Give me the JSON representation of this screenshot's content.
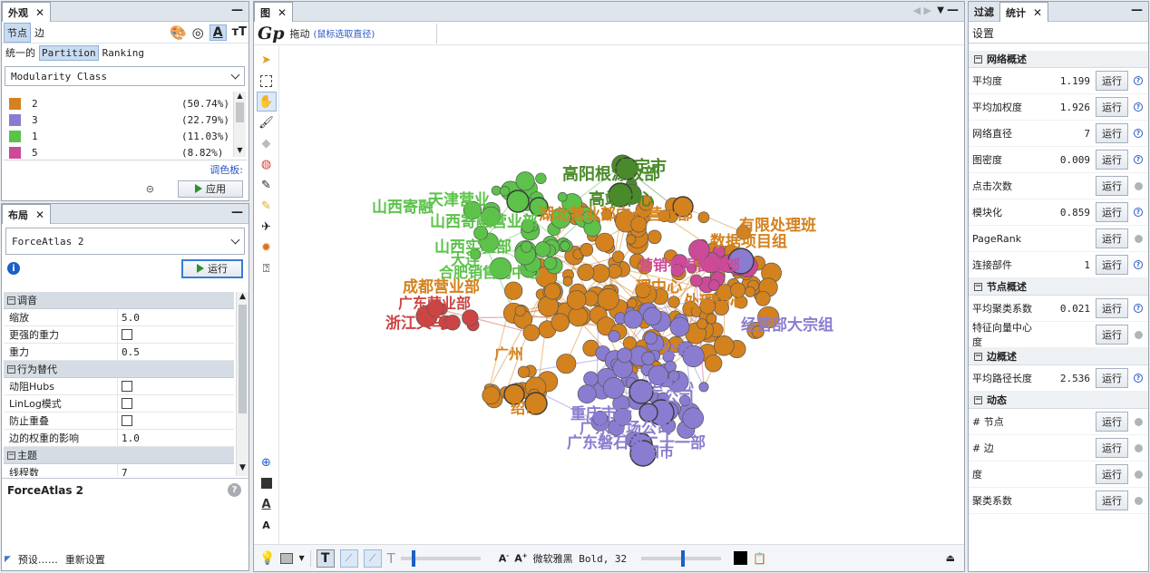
{
  "appearance": {
    "tab": "外观",
    "node_tab": "节点",
    "edge_tab": "边",
    "unified": "统一的",
    "partition": "Partition",
    "ranking": "Ranking",
    "attribute": "Modularity Class",
    "partitions": [
      {
        "label": "2",
        "pct": "(50.74%)",
        "color": "#d4821e"
      },
      {
        "label": "3",
        "pct": "(22.79%)",
        "color": "#8a7cd0"
      },
      {
        "label": "1",
        "pct": "(11.03%)",
        "color": "#5cc24a"
      },
      {
        "label": "5",
        "pct": "(8.82%)",
        "color": "#cc4a98"
      }
    ],
    "palette_link": "调色板:",
    "apply": "应用"
  },
  "layout": {
    "tab": "布局",
    "algorithm": "ForceAtlas 2",
    "run": "运行",
    "categories": [
      {
        "title": "调音",
        "props": [
          {
            "name": "缩放",
            "value": "5.0",
            "type": "text"
          },
          {
            "name": "更强的重力",
            "value": "",
            "type": "check"
          },
          {
            "name": "重力",
            "value": "0.5",
            "type": "text"
          }
        ]
      },
      {
        "title": "行为替代",
        "props": [
          {
            "name": "动阻Hubs",
            "value": "",
            "type": "check"
          },
          {
            "name": "LinLog模式",
            "value": "",
            "type": "check"
          },
          {
            "name": "防止重叠",
            "value": "",
            "type": "check"
          },
          {
            "name": "边的权重的影响",
            "value": "1.0",
            "type": "text"
          }
        ]
      },
      {
        "title": "主题",
        "props": [
          {
            "name": "线程数",
            "value": "7",
            "type": "text"
          }
        ]
      }
    ],
    "description_title": "ForceAtlas 2",
    "presets": "预设……",
    "reset": "重新设置"
  },
  "graph": {
    "tab": "图",
    "mode": "拖动",
    "hint": "(鼠标选取直径)",
    "font_label": "微软雅黑 Bold, 32",
    "labels": [
      {
        "text": "高阳根源收部",
        "color": "#4a8a2a"
      },
      {
        "text": "保定市",
        "color": "#4a8a2a"
      },
      {
        "text": "山西寄融",
        "color": "#5cc24a"
      },
      {
        "text": "天津营业",
        "color": "#5cc24a"
      },
      {
        "text": "高端中心",
        "color": "#4a8a2a"
      },
      {
        "text": "湖北营业部中心营业部",
        "color": "#d4821e"
      },
      {
        "text": "有限处理班",
        "color": "#d4821e"
      },
      {
        "text": "山西寄融营业部",
        "color": "#5cc24a"
      },
      {
        "text": "山西实验部",
        "color": "#5cc24a"
      },
      {
        "text": "数据项目组",
        "color": "#d4821e"
      },
      {
        "text": "大连",
        "color": "#5cc24a"
      },
      {
        "text": "合肥销售向中心",
        "color": "#5cc24a"
      },
      {
        "text": "营销有限营业部",
        "color": "#cc4a98"
      },
      {
        "text": "成都营业部",
        "color": "#d4821e"
      },
      {
        "text": "理中心",
        "color": "#d4821e"
      },
      {
        "text": "处理中心",
        "color": "#d4821e"
      },
      {
        "text": "广东营业部",
        "color": "#cc4444"
      },
      {
        "text": "浙江义乌",
        "color": "#cc4444"
      },
      {
        "text": "经营部大宗组",
        "color": "#8a7cd0"
      },
      {
        "text": "公司",
        "color": "#8a7cd0"
      },
      {
        "text": "广州",
        "color": "#d4821e"
      },
      {
        "text": "运中心",
        "color": "#8a7cd0"
      },
      {
        "text": "公司",
        "color": "#8a7cd0"
      },
      {
        "text": "绍市",
        "color": "#d4821e"
      },
      {
        "text": "重庆市场",
        "color": "#8a7cd0"
      },
      {
        "text": "广东市场公司",
        "color": "#8a7cd0"
      },
      {
        "text": "广东磐石第二十一部",
        "color": "#8a7cd0"
      },
      {
        "text": "揭阳市",
        "color": "#8a7cd0"
      }
    ]
  },
  "statistics": {
    "filter_tab": "过滤",
    "stats_tab": "统计",
    "settings": "设置",
    "run_label": "运行",
    "groups": [
      {
        "title": "网络概述",
        "rows": [
          {
            "name": "平均度",
            "value": "1.199",
            "info": true
          },
          {
            "name": "平均加权度",
            "value": "1.926",
            "info": true
          },
          {
            "name": "网络直径",
            "value": "7",
            "info": true
          },
          {
            "name": "图密度",
            "value": "0.009",
            "info": true
          },
          {
            "name": "点击次数",
            "value": "",
            "info": false
          },
          {
            "name": "模块化",
            "value": "0.859",
            "info": true
          },
          {
            "name": "PageRank",
            "value": "",
            "info": false
          },
          {
            "name": "连接部件",
            "value": "1",
            "info": true
          }
        ]
      },
      {
        "title": "节点概述",
        "rows": [
          {
            "name": "平均聚类系数",
            "value": "0.021",
            "info": true
          },
          {
            "name": "特征向量中心度",
            "value": "",
            "info": false
          }
        ]
      },
      {
        "title": "边概述",
        "rows": [
          {
            "name": "平均路径长度",
            "value": "2.536",
            "info": true
          }
        ]
      },
      {
        "title": "动态",
        "rows": [
          {
            "name": "# 节点",
            "value": "",
            "info": false
          },
          {
            "name": "# 边",
            "value": "",
            "info": false
          },
          {
            "name": "度",
            "value": "",
            "info": false
          },
          {
            "name": "聚类系数",
            "value": "",
            "info": false
          }
        ]
      }
    ]
  }
}
